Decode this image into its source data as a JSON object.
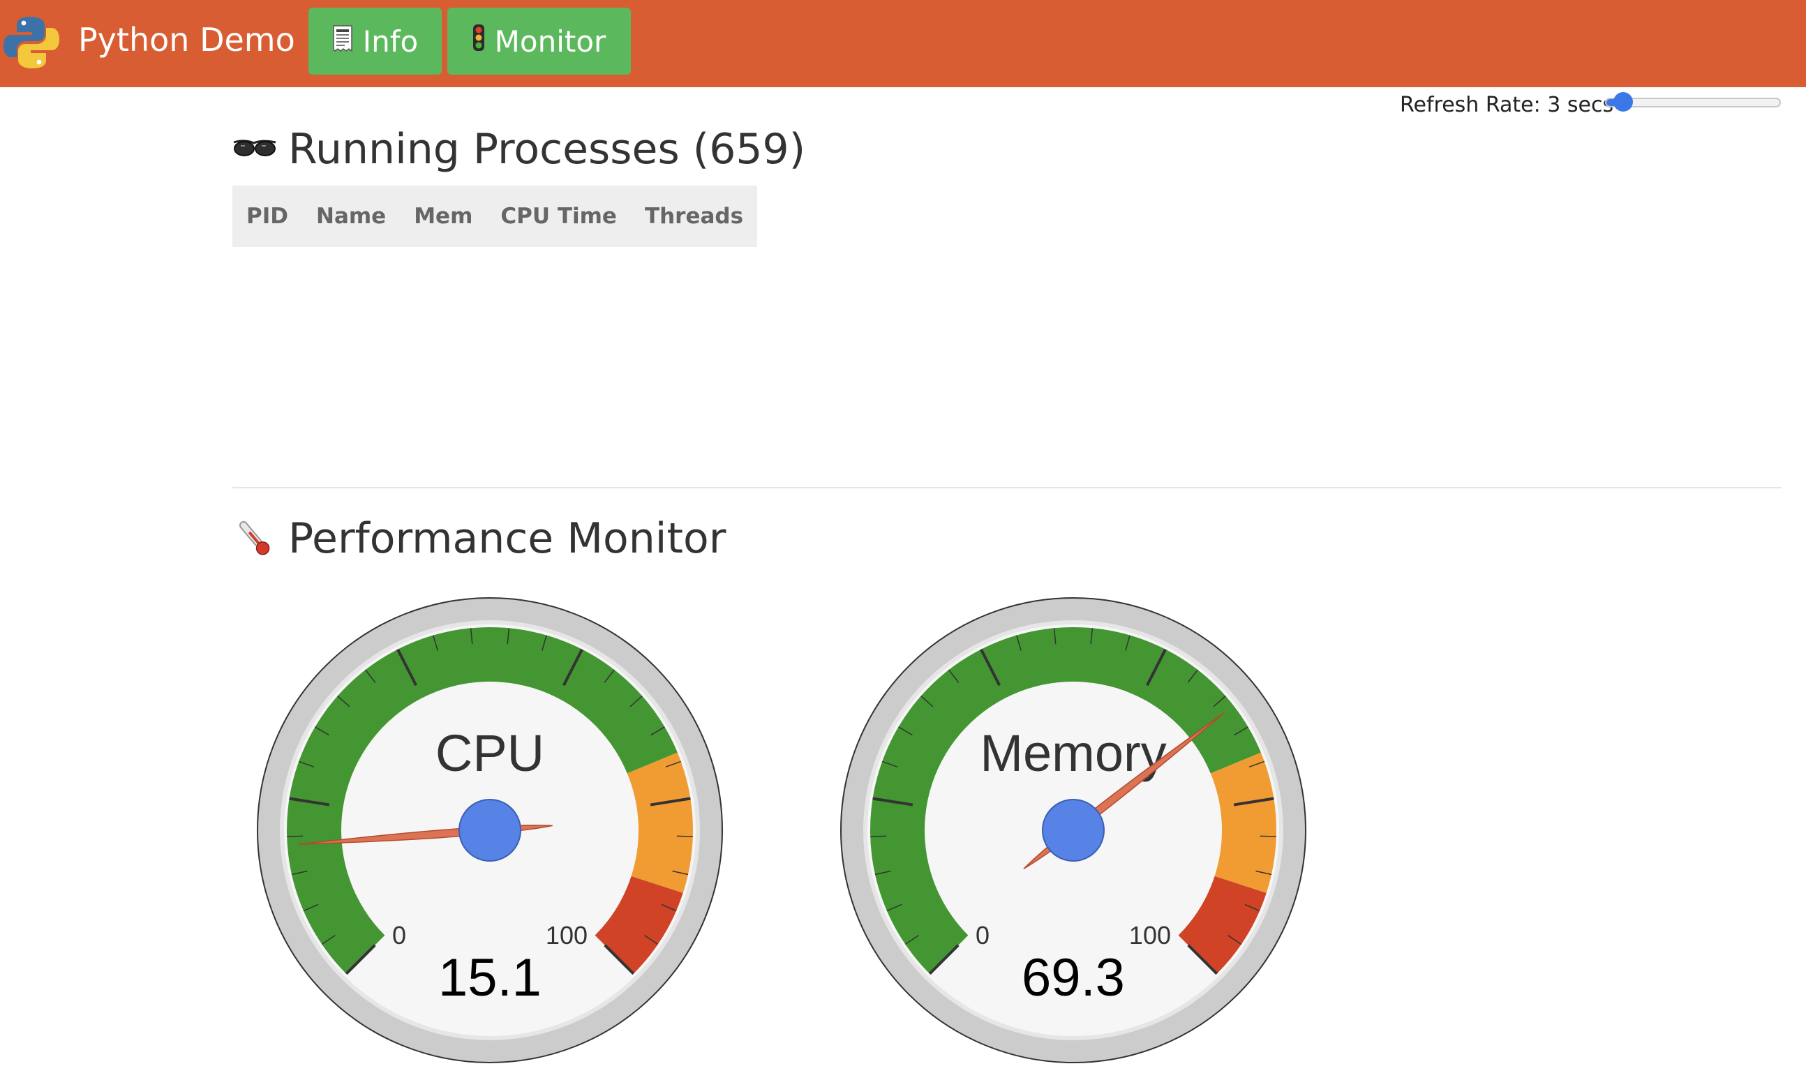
{
  "navbar": {
    "brand": "Python Demo",
    "brand_icon": "python-logo",
    "buttons": [
      {
        "label": "Info",
        "icon": "receipt-icon"
      },
      {
        "label": "Monitor",
        "icon": "traffic-light-icon"
      }
    ],
    "background_color": "#d95d32",
    "button_color": "#5cb85c"
  },
  "refresh": {
    "label": "Refresh Rate: 3 secs",
    "value": 3,
    "accent_color": "#3b78e7"
  },
  "processes": {
    "icon": "glasses-icon",
    "title": "Running Processes (659)",
    "columns": [
      "PID",
      "Name",
      "Mem",
      "CPU Time",
      "Threads"
    ],
    "rows": []
  },
  "performance": {
    "icon": "thermometer-icon",
    "title": "Performance Monitor",
    "gauges": [
      {
        "label": "CPU",
        "value": "15.1",
        "min": "0",
        "max": "100"
      },
      {
        "label": "Memory",
        "value": "69.3",
        "min": "0",
        "max": "100"
      }
    ],
    "zone_colors": {
      "green": "#439632",
      "orange": "#f19c33",
      "red": "#d04326",
      "needle": "#dd7355",
      "hub": "#5782e6"
    }
  }
}
